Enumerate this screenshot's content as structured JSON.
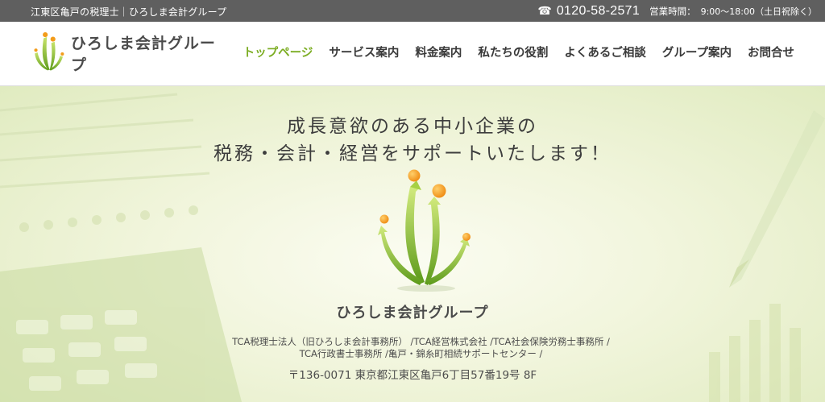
{
  "topbar": {
    "tagline": "江東区亀戸の税理士｜ひろしま会計グループ",
    "phone_icon": "☎",
    "phone": "0120-58-2571",
    "hours_label": "営業時間：",
    "hours": "9:00〜18:00（土日祝除く）"
  },
  "header": {
    "logo_text": "ひろしま会計グループ",
    "nav": [
      {
        "label": "トップページ",
        "active": true
      },
      {
        "label": "サービス案内"
      },
      {
        "label": "料金案内"
      },
      {
        "label": "私たちの役割"
      },
      {
        "label": "よくあるご相談"
      },
      {
        "label": "グループ案内"
      },
      {
        "label": "お問合せ"
      }
    ]
  },
  "hero": {
    "headline_1": "成長意欲のある中小企業の",
    "headline_2": "税務・会計・経営をサポートいたします！",
    "brand": "ひろしま会計グループ",
    "entities_1": "TCA税理士法人（旧ひろしま会計事務所） /TCA経営株式会社 /TCA社会保険労務士事務所 /",
    "entities_2": "TCA行政書士事務所 /亀戸・錦糸町相続サポートセンター /",
    "address": "〒136-0071 東京都江東区亀戸6丁目57番19号 8F"
  },
  "colors": {
    "topbar_bg": "#5f5f5f",
    "nav_active": "#7cad23",
    "logo_green": "#8cbf26",
    "logo_orange": "#f39c1a"
  },
  "icons": [
    "phone-icon",
    "logo-emblem-icon",
    "hero-emblem-icon"
  ]
}
